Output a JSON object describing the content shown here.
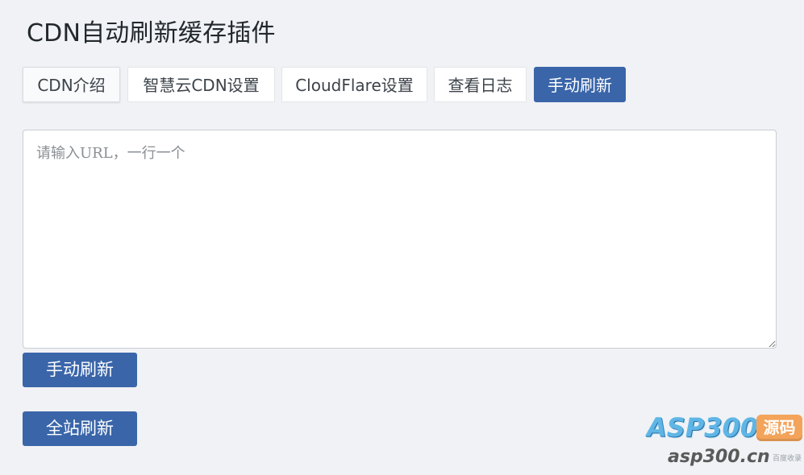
{
  "page": {
    "title": "CDN自动刷新缓存插件"
  },
  "tabs": [
    {
      "label": "CDN介绍"
    },
    {
      "label": "智慧云CDN设置"
    },
    {
      "label": "CloudFlare设置"
    },
    {
      "label": "查看日志"
    },
    {
      "label": "手动刷新",
      "active": true
    }
  ],
  "url_input": {
    "placeholder": "请输入URL，一行一个",
    "value": ""
  },
  "buttons": {
    "manual_refresh": "手动刷新",
    "full_site_refresh": "全站刷新"
  },
  "watermark": {
    "brand": "ASP300",
    "badge": "源码",
    "url": "asp300.cn",
    "small_text": "百度收录"
  },
  "colors": {
    "background": "#f0f2f5",
    "primary": "#3a65a9",
    "tab_background": "#ffffff",
    "text": "#23282d"
  }
}
